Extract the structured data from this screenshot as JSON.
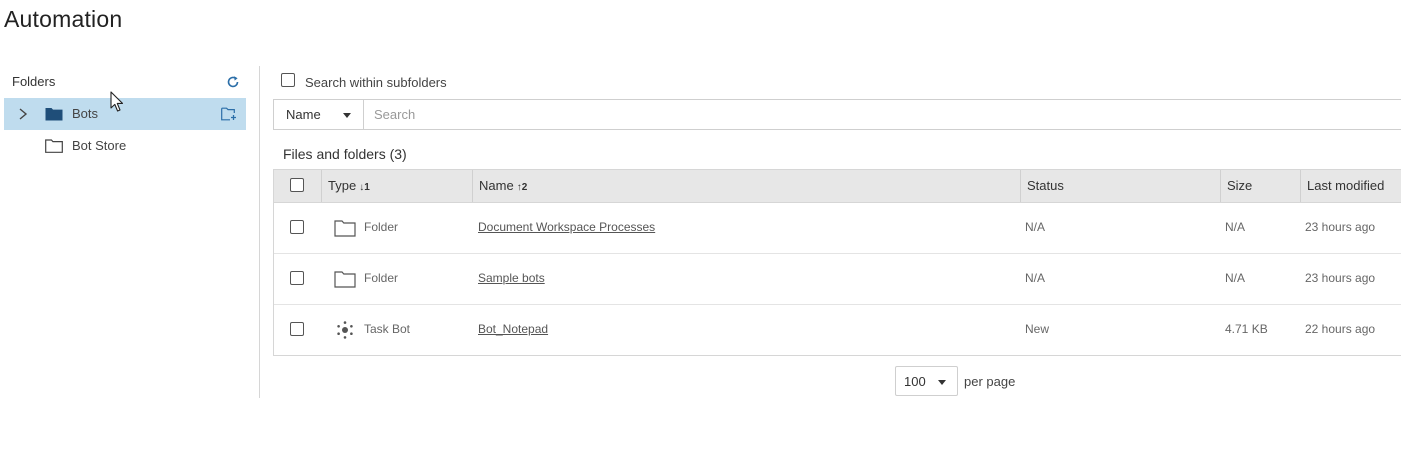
{
  "page": {
    "title": "Automation"
  },
  "folders": {
    "heading": "Folders",
    "items": [
      {
        "label": "Bots",
        "selected": true,
        "expandable": true
      },
      {
        "label": "Bot Store",
        "selected": false,
        "expandable": false
      }
    ]
  },
  "search": {
    "subfolders_label": "Search within subfolders",
    "field_select": "Name",
    "placeholder": "Search"
  },
  "files": {
    "title": "Files and folders (3)",
    "columns": [
      {
        "label": "Type",
        "sort": "↓1"
      },
      {
        "label": "Name",
        "sort": "↑2"
      },
      {
        "label": "Status",
        "sort": ""
      },
      {
        "label": "Size",
        "sort": ""
      },
      {
        "label": "Last modified",
        "sort": ""
      }
    ],
    "rows": [
      {
        "type": "Folder",
        "type_icon": "folder-icon",
        "name": "Document Workspace Processes",
        "status": "N/A",
        "size": "N/A",
        "modified": "23 hours ago"
      },
      {
        "type": "Folder",
        "type_icon": "folder-icon",
        "name": "Sample bots",
        "status": "N/A",
        "size": "N/A",
        "modified": "23 hours ago"
      },
      {
        "type": "Task Bot",
        "type_icon": "task-bot-icon",
        "name": "Bot_Notepad",
        "status": "New",
        "size": "4.71 KB",
        "modified": "22 hours ago"
      }
    ]
  },
  "pagination": {
    "page_size": "100",
    "per_page_label": "per page"
  },
  "colors": {
    "selected_bg": "#bfdcee",
    "header_bg": "#e7e7e7",
    "folder_fill": "#1f4e79"
  }
}
